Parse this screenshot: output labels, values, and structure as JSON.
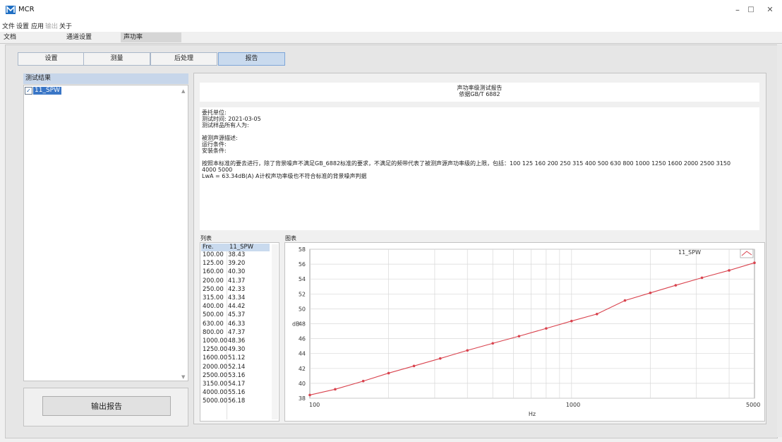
{
  "app": {
    "title": "MCR",
    "minimize": "–",
    "maximize": "□",
    "close": "✕"
  },
  "menu": [
    "文件",
    "设置",
    "应用",
    "输出",
    "关于"
  ],
  "top_tabs": [
    "文档",
    "通道设置",
    "声功率"
  ],
  "sub_tabs": [
    "设置",
    "测量",
    "后处理",
    "报告"
  ],
  "results": {
    "header": "测试结果",
    "items": [
      "11_SPW"
    ]
  },
  "export_button": "输出报告",
  "report": {
    "title": "声功率级测试报告",
    "subtitle": "依据GB/T 6882",
    "lines": [
      "委托单位:",
      "测试时间: 2021-03-05",
      "测试样品所有人为:",
      "",
      "被测声源描述:",
      "运行条件:",
      "安装条件:",
      "",
      "按照本标准的要去进行，除了背景噪声不满足GB_6882标准的要求，不满足的频带代表了被测声源声功率级的上限，包括：100 125 160 200 250 315 400 500 630 800 1000 1250 1600 2000 2500 3150",
      "4000 5000",
      "LwA = 63.34dB(A)   A计权声功率级也不符合标准的背景噪声判据"
    ]
  },
  "table": {
    "label": "列表",
    "headers": [
      "Fre.",
      "11_SPW"
    ],
    "rows": [
      [
        "100.00",
        "38.43"
      ],
      [
        "125.00",
        "39.20"
      ],
      [
        "160.00",
        "40.30"
      ],
      [
        "200.00",
        "41.37"
      ],
      [
        "250.00",
        "42.33"
      ],
      [
        "315.00",
        "43.34"
      ],
      [
        "400.00",
        "44.42"
      ],
      [
        "500.00",
        "45.37"
      ],
      [
        "630.00",
        "46.33"
      ],
      [
        "800.00",
        "47.37"
      ],
      [
        "1000.00",
        "48.36"
      ],
      [
        "1250.00",
        "49.30"
      ],
      [
        "1600.00",
        "51.12"
      ],
      [
        "2000.00",
        "52.14"
      ],
      [
        "2500.00",
        "53.16"
      ],
      [
        "3150.00",
        "54.17"
      ],
      [
        "4000.00",
        "55.16"
      ],
      [
        "5000.00",
        "56.18"
      ]
    ]
  },
  "chart_label": "图表",
  "chart_data": {
    "type": "line",
    "x_scale": "log",
    "x": [
      100,
      125,
      160,
      200,
      250,
      315,
      400,
      500,
      630,
      800,
      1000,
      1250,
      1600,
      2000,
      2500,
      3150,
      4000,
      5000
    ],
    "series": [
      {
        "name": "11_SPW",
        "color": "#d9434e",
        "values": [
          38.43,
          39.2,
          40.3,
          41.37,
          42.33,
          43.34,
          44.42,
          45.37,
          46.33,
          47.37,
          48.36,
          49.3,
          51.12,
          52.14,
          53.16,
          54.17,
          55.16,
          56.18
        ]
      }
    ],
    "xlabel": "Hz",
    "ylabel": "dB",
    "xlim": [
      100,
      5000
    ],
    "ylim": [
      38,
      58
    ],
    "x_ticks": [
      "100",
      "1000",
      "5000"
    ],
    "y_ticks": [
      "38",
      "40",
      "42",
      "44",
      "46",
      "48",
      "50",
      "52",
      "54",
      "56",
      "58"
    ],
    "legend": "top-right",
    "grid": true
  }
}
